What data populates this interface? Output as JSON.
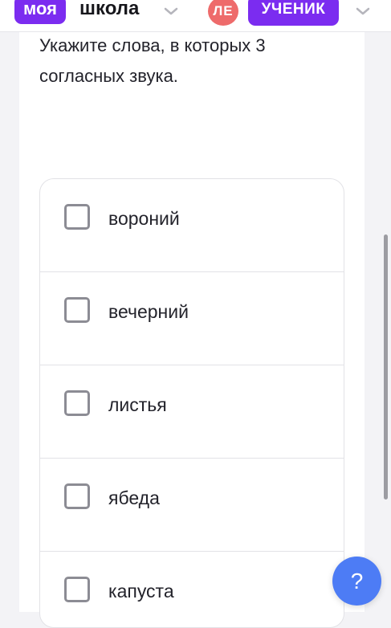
{
  "header": {
    "logo_badge": "моя",
    "logo_text": "школа",
    "avatar_initials": "ЛЕ",
    "role": "УЧЕНИК"
  },
  "question": {
    "text": "Укажите слова, в которых 3 согласных звука."
  },
  "options": [
    {
      "label": "вороний",
      "checked": false
    },
    {
      "label": "вечерний",
      "checked": false
    },
    {
      "label": "листья",
      "checked": false
    },
    {
      "label": "ябеда",
      "checked": false
    },
    {
      "label": "капуста",
      "checked": false
    }
  ],
  "help_button": {
    "label": "?"
  },
  "colors": {
    "brand": "#7b2cf0",
    "avatar": "#ee6b6b",
    "help": "#4d7cf5"
  }
}
